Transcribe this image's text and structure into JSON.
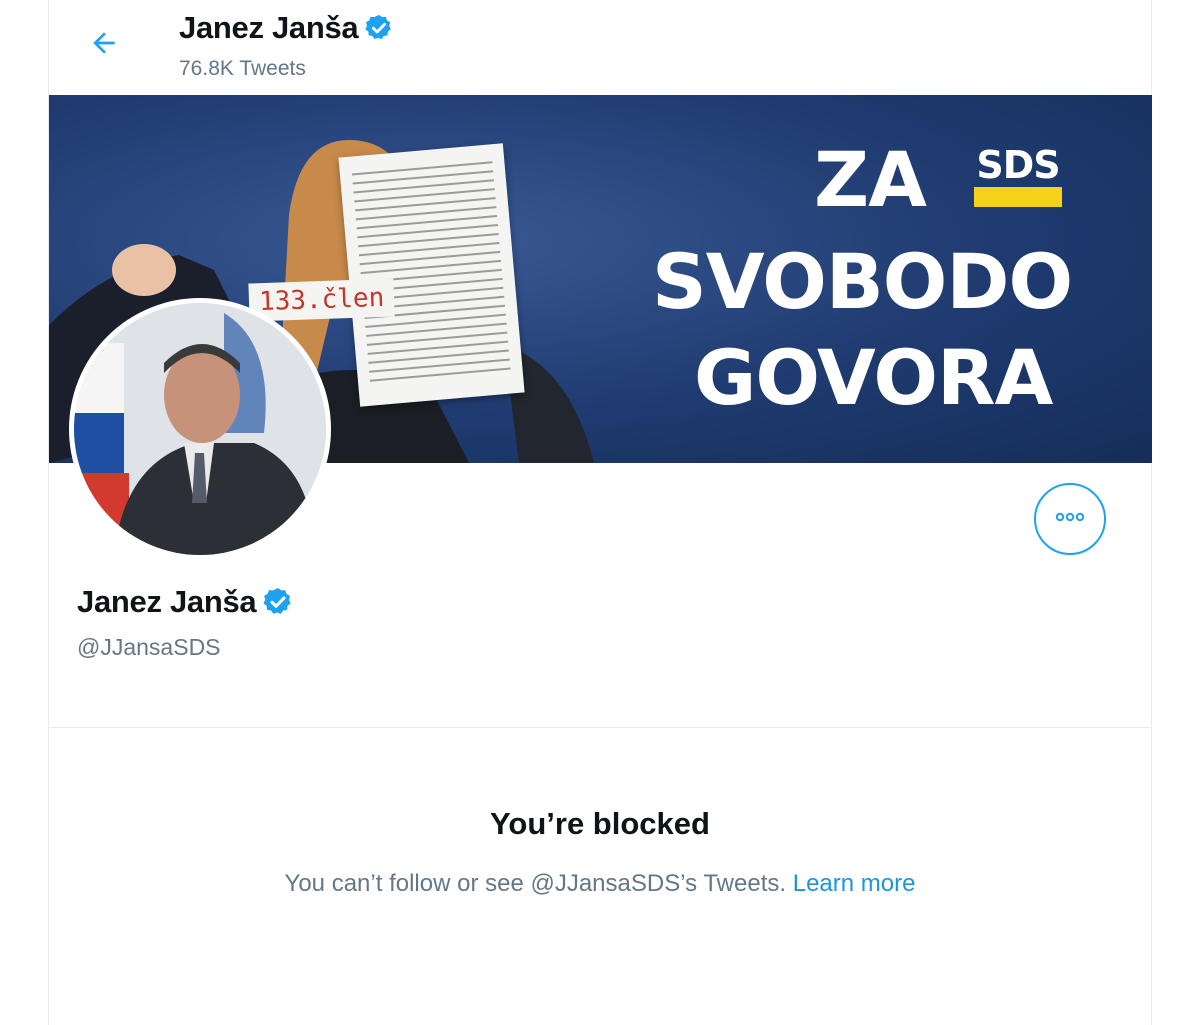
{
  "header": {
    "name": "Janez Janša",
    "tweet_count": "76.8K Tweets",
    "back_icon": "back-arrow-icon"
  },
  "banner": {
    "slogan_line1": "ZA",
    "slogan_line2": "SVOBODO",
    "slogan_line3": "GOVORA",
    "logo_text": "SDS",
    "article_label": "133.člen"
  },
  "profile": {
    "name": "Janez Janša",
    "handle": "@JJansaSDS",
    "verified": true,
    "more_icon": "more-options-icon"
  },
  "blocked": {
    "title": "You’re blocked",
    "message": "You can’t follow or see @JJansaSDS’s Tweets.",
    "link_label": "Learn more"
  },
  "colors": {
    "accent": "#1da1f2",
    "link": "#1b95e0",
    "secondary_text": "#657786",
    "banner_bg": "#1f3b70",
    "logo_yellow": "#f6d11b"
  }
}
